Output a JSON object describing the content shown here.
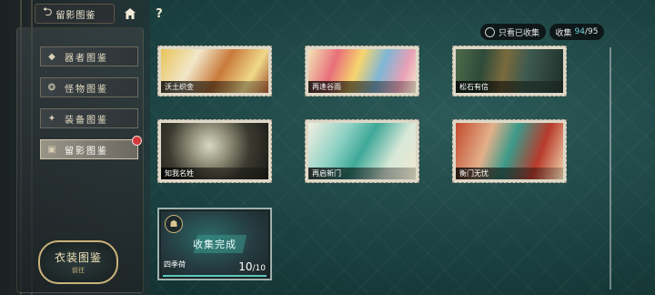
{
  "header": {
    "back_label": "留影图鉴",
    "back_icon": "return-arrow-icon",
    "home_icon": "home-icon",
    "help_label": "?"
  },
  "nav": {
    "items": [
      {
        "label": "器者图鉴",
        "icon": "diamond-icon",
        "active": false
      },
      {
        "label": "怪物图鉴",
        "icon": "monster-icon",
        "active": false
      },
      {
        "label": "装备图鉴",
        "icon": "equipment-icon",
        "active": false
      },
      {
        "label": "留影图鉴",
        "icon": "photo-icon",
        "active": true,
        "badge": true
      }
    ],
    "costume": {
      "title": "衣装图鉴",
      "sub": "前往"
    }
  },
  "filter": {
    "label": "只看已收集"
  },
  "collection": {
    "label": "收集",
    "current": "94",
    "total": "/95"
  },
  "cards": [
    {
      "name": "沃土织金"
    },
    {
      "name": "再逢谷雨"
    },
    {
      "name": "松石有信"
    },
    {
      "name": "知我名姓"
    },
    {
      "name": "再启新门"
    },
    {
      "name": "衡门无忧"
    }
  ],
  "completed_card": {
    "name": "四季荷",
    "status": "收集完成",
    "count": "10",
    "total": "/10",
    "progress": 1.0,
    "icon": "gift-icon"
  },
  "colors": {
    "accent": "#6fd0d8",
    "badge": "#d03a3a"
  }
}
